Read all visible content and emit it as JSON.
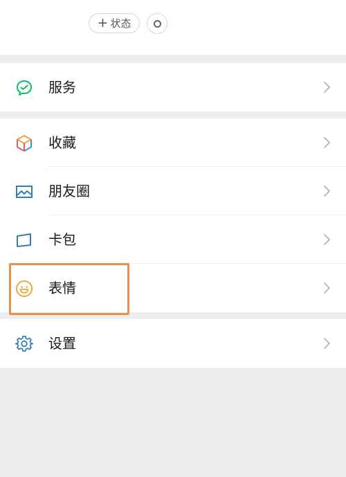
{
  "header": {
    "status_button": {
      "plus": "+",
      "label": "状态"
    },
    "circle_icon": "ring-icon"
  },
  "groups": [
    {
      "items": [
        {
          "label": "服务",
          "icon": "wechat-services-icon"
        }
      ]
    },
    {
      "items": [
        {
          "label": "收藏",
          "icon": "favorites-cube-icon"
        },
        {
          "label": "朋友圈",
          "icon": "moments-image-icon"
        },
        {
          "label": "卡包",
          "icon": "card-wallet-icon"
        },
        {
          "label": "表情",
          "icon": "emoji-smile-icon"
        }
      ]
    },
    {
      "items": [
        {
          "label": "设置",
          "icon": "settings-gear-icon"
        }
      ]
    }
  ],
  "colors": {
    "background": "#ededed",
    "row": "#ffffff",
    "wechat_green": "#07c160",
    "highlight_orange": "#e8914d",
    "emoji_yellow": "#e8a93a",
    "blue_icon": "#2f7fb6"
  }
}
